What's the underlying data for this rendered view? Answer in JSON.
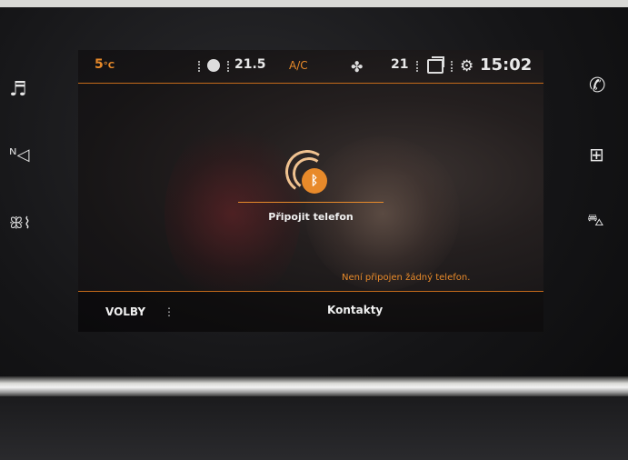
{
  "status_bar": {
    "outside_temp": "5",
    "outside_temp_unit": "°C",
    "cabin_temp_left": "21.5",
    "ac_label": "A/C",
    "cabin_temp_right": "21",
    "clock": "15:02"
  },
  "main": {
    "bluetooth_symbol": "ᛒ",
    "connect_phone_label": "Připojit telefon",
    "notice": "Není připojen žádný telefon."
  },
  "bottom_bar": {
    "options_label": "VOLBY",
    "menu_dots": "⋮",
    "contacts_label": "Kontakty"
  },
  "side_buttons": {
    "left": [
      "music-icon",
      "navigation-icon",
      "climate-icon"
    ],
    "right": [
      "phone-icon",
      "apps-icon",
      "car-icon"
    ]
  },
  "colors": {
    "accent": "#e88a2a",
    "text": "#f0f0f0"
  }
}
